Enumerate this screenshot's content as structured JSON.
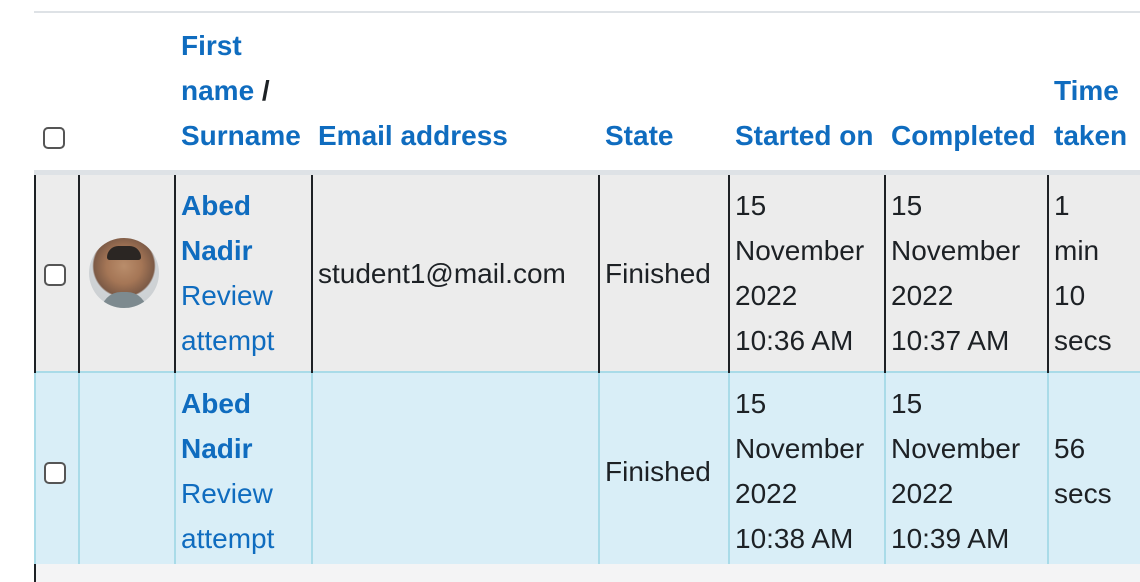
{
  "header": {
    "first_name": "First name",
    "sep": " /",
    "surname": "Surname",
    "email": "Email address",
    "state": "State",
    "started_on": "Started on",
    "completed": "Completed",
    "time_taken": "Time taken"
  },
  "rows": [
    {
      "name_first": "Abed",
      "name_last": "Nadir",
      "review": "Review attempt",
      "email": "student1@mail.com",
      "state": "Finished",
      "started": [
        "15",
        "November",
        "2022",
        "10:36 AM"
      ],
      "completed": [
        "15",
        "November",
        "2022",
        "10:37 AM"
      ],
      "time_taken": [
        "1",
        "min",
        "10",
        "secs"
      ]
    },
    {
      "name_first": "Abed",
      "name_last": "Nadir",
      "review": "Review attempt",
      "email": "",
      "state": "Finished",
      "started": [
        "15",
        "November",
        "2022",
        "10:38 AM"
      ],
      "completed": [
        "15",
        "November",
        "2022",
        "10:39 AM"
      ],
      "time_taken": [
        "56",
        "secs"
      ]
    }
  ],
  "colors": {
    "link": "#0f6cbf",
    "row_highlight": "#d9eef7",
    "row_grey": "#ececec"
  }
}
